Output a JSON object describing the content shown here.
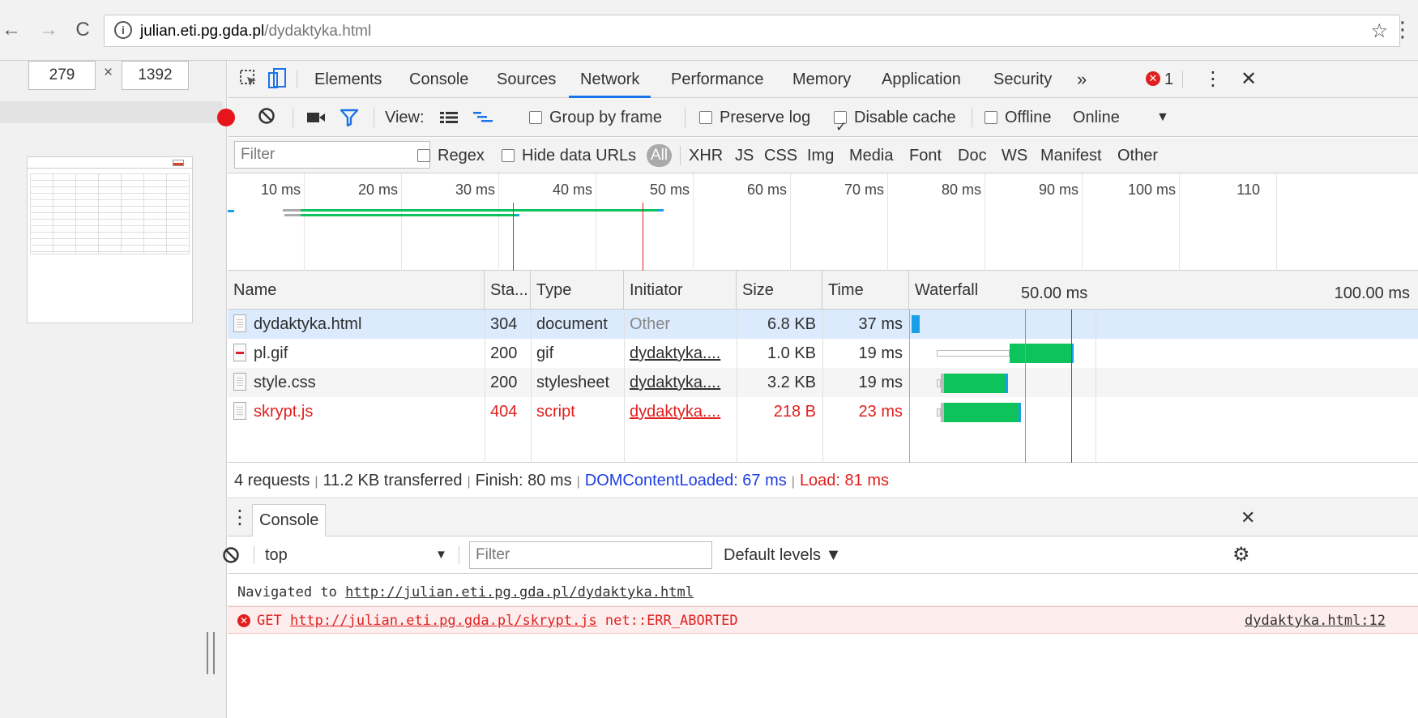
{
  "browser": {
    "url_host": "julian.eti.pg.gda.pl",
    "url_path": "/dydaktyka.html"
  },
  "device": {
    "width": "279",
    "times": "×",
    "height": "1392"
  },
  "devtools": {
    "tabs": [
      "Elements",
      "Console",
      "Sources",
      "Network",
      "Performance",
      "Memory",
      "Application",
      "Security"
    ],
    "active_tab": "Network",
    "more": "»",
    "error_count": "1"
  },
  "toolbar": {
    "view_label": "View:",
    "group_by_frame": "Group by frame",
    "preserve_log": "Preserve log",
    "disable_cache": "Disable cache",
    "offline": "Offline",
    "throttle": "Online",
    "disable_cache_checked": true
  },
  "filterbar": {
    "placeholder": "Filter",
    "regex": "Regex",
    "hide_data_urls": "Hide data URLs",
    "types": [
      "All",
      "XHR",
      "JS",
      "CSS",
      "Img",
      "Media",
      "Font",
      "Doc",
      "WS",
      "Manifest",
      "Other"
    ]
  },
  "overview": {
    "ticks": [
      "10 ms",
      "20 ms",
      "30 ms",
      "40 ms",
      "50 ms",
      "60 ms",
      "70 ms",
      "80 ms",
      "90 ms",
      "100 ms",
      "110"
    ]
  },
  "table": {
    "headers": [
      "Name",
      "Sta...",
      "Type",
      "Initiator",
      "Size",
      "Time",
      "Waterfall"
    ],
    "waterfall_ticks": [
      "50.00 ms",
      "100.00 ms"
    ],
    "rows": [
      {
        "name": "dydaktyka.html",
        "status": "304",
        "type": "document",
        "initiator": "Other",
        "size": "6.8 KB",
        "time": "37 ms"
      },
      {
        "name": "pl.gif",
        "status": "200",
        "type": "gif",
        "initiator": "dydaktyka....",
        "size": "1.0 KB",
        "time": "19 ms"
      },
      {
        "name": "style.css",
        "status": "200",
        "type": "stylesheet",
        "initiator": "dydaktyka....",
        "size": "3.2 KB",
        "time": "19 ms"
      },
      {
        "name": "skrypt.js",
        "status": "404",
        "type": "script",
        "initiator": "dydaktyka....",
        "size": "218 B",
        "time": "23 ms"
      }
    ]
  },
  "summary": {
    "requests": "4 requests",
    "transferred": "11.2 KB transferred",
    "finish": "Finish: 80 ms",
    "dom": "DOMContentLoaded: 67 ms",
    "load": "Load: 81 ms"
  },
  "console": {
    "tab": "Console",
    "context": "top",
    "filter_placeholder": "Filter",
    "levels": "Default levels ▼",
    "nav_prefix": "Navigated to ",
    "nav_url": "http://julian.eti.pg.gda.pl/dydaktyka.html",
    "err_method": "GET ",
    "err_url": "http://julian.eti.pg.gda.pl/skrypt.js",
    "err_text": " net::ERR_ABORTED",
    "err_source": "dydaktyka.html:12"
  },
  "colors": {
    "accent": "#1a73e8",
    "error": "#e0201e",
    "dom_line": "#1f3ee0",
    "bar_green": "#0dc35b"
  }
}
